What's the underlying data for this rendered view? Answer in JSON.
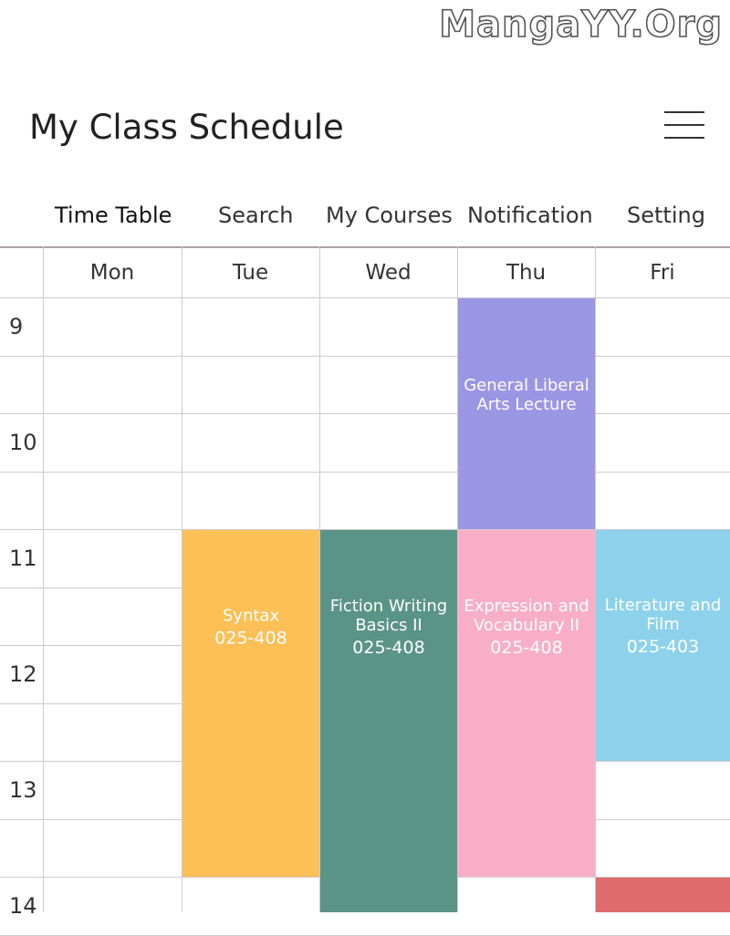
{
  "watermark": "MangaYY.Org",
  "header": {
    "title": "My Class Schedule"
  },
  "nav": {
    "tabs": [
      {
        "label": "Time Table",
        "active": true
      },
      {
        "label": "Search"
      },
      {
        "label": "My Courses"
      },
      {
        "label": "Notification"
      },
      {
        "label": "Setting"
      }
    ]
  },
  "schedule": {
    "days": [
      "Mon",
      "Tue",
      "Wed",
      "Thu",
      "Fri"
    ],
    "hours": [
      "9",
      "10",
      "11",
      "12",
      "13",
      "14"
    ],
    "courses": [
      {
        "day": "Thu",
        "name": "General Liberal Arts Lecture",
        "room": "",
        "start": "9:00",
        "end": "11:00",
        "color": "#9b96e4"
      },
      {
        "day": "Tue",
        "name": "Syntax",
        "room": "025-408",
        "start": "11:00",
        "end": "14:00",
        "color": "#fcc056"
      },
      {
        "day": "Wed",
        "name": "Fiction Writing Basics II",
        "room": "025-408",
        "start": "11:00",
        "end": "14:30",
        "color": "#5a9486"
      },
      {
        "day": "Thu",
        "name": "Expression and Vocabulary II",
        "room": "025-408",
        "start": "11:00",
        "end": "14:00",
        "color": "#f9aec7"
      },
      {
        "day": "Fri",
        "name": "Literature and Film",
        "room": "025-403",
        "start": "11:00",
        "end": "13:00",
        "color": "#8dd2ea"
      },
      {
        "day": "Fri",
        "name": "",
        "room": "",
        "start": "14:00",
        "end": "14:30",
        "color": "#e06b6d"
      }
    ]
  }
}
